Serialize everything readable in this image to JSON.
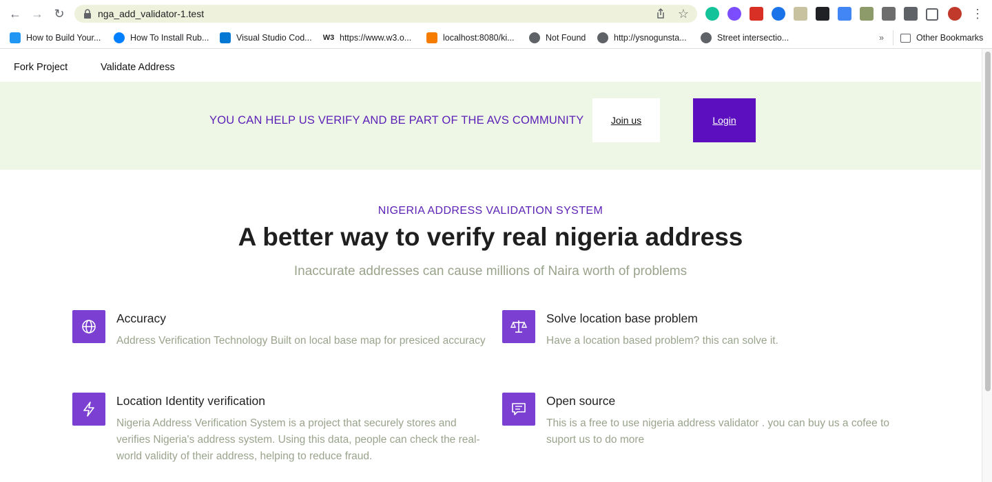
{
  "browser": {
    "url": "nga_add_validator-1.test",
    "bookmarks": [
      "How to Build Your...",
      "How To Install Rub...",
      "Visual Studio Cod...",
      "https://www.w3.o...",
      "localhost:8080/ki...",
      "Not Found",
      "http://ysnogunsta...",
      "Street intersectio..."
    ],
    "overflow": "»",
    "other_bookmarks": "Other Bookmarks"
  },
  "nav": {
    "fork": "Fork Project",
    "validate": "Validate Address"
  },
  "banner": {
    "text": "YOU CAN HELP US VERIFY AND BE PART OF THE AVS COMMUNITY",
    "join": "Join us",
    "login": "Login"
  },
  "hero": {
    "eyebrow": "NIGERIA ADDRESS VALIDATION SYSTEM",
    "title": "A better way to verify real nigeria address",
    "subtitle": "Inaccurate addresses can cause millions of Naira worth of problems"
  },
  "features": [
    {
      "icon": "globe-icon",
      "title": "Accuracy",
      "desc": "Address Verification Technology Built on local base map for presiced accuracy"
    },
    {
      "icon": "scale-icon",
      "title": "Solve location base problem",
      "desc": "Have a location based problem? this can solve it."
    },
    {
      "icon": "lightning-icon",
      "title": "Location Identity verification",
      "desc": "Nigeria Address Verification System is a project that securely stores and verifies Nigeria's address system. Using this data, people can check the real-world validity of their address, helping to reduce fraud."
    },
    {
      "icon": "chat-icon",
      "title": "Open source",
      "desc": "This is a free to use nigeria address validator . you can buy us a cofee to suport us to do more"
    }
  ],
  "colors": {
    "accent": "#5b21b6",
    "login_bg": "#5b0fbf",
    "icon_bg": "#7b3fd2",
    "banner_bg": "#eef6e6",
    "muted_text": "#9aa38c"
  }
}
